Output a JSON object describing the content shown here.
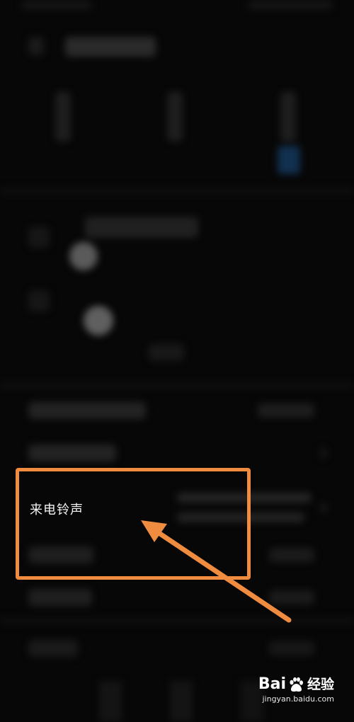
{
  "settings_row": {
    "label": "来电铃声"
  },
  "annotation": {
    "box_color": "#f08c40",
    "arrow_color": "#f08c40"
  },
  "watermark": {
    "brand_left": "Bai",
    "brand_right": "经验",
    "url": "jingyan.baidu.com"
  },
  "icons": {
    "watermark_logo": "baidu-paw-icon",
    "pointer": "arrow-icon"
  }
}
